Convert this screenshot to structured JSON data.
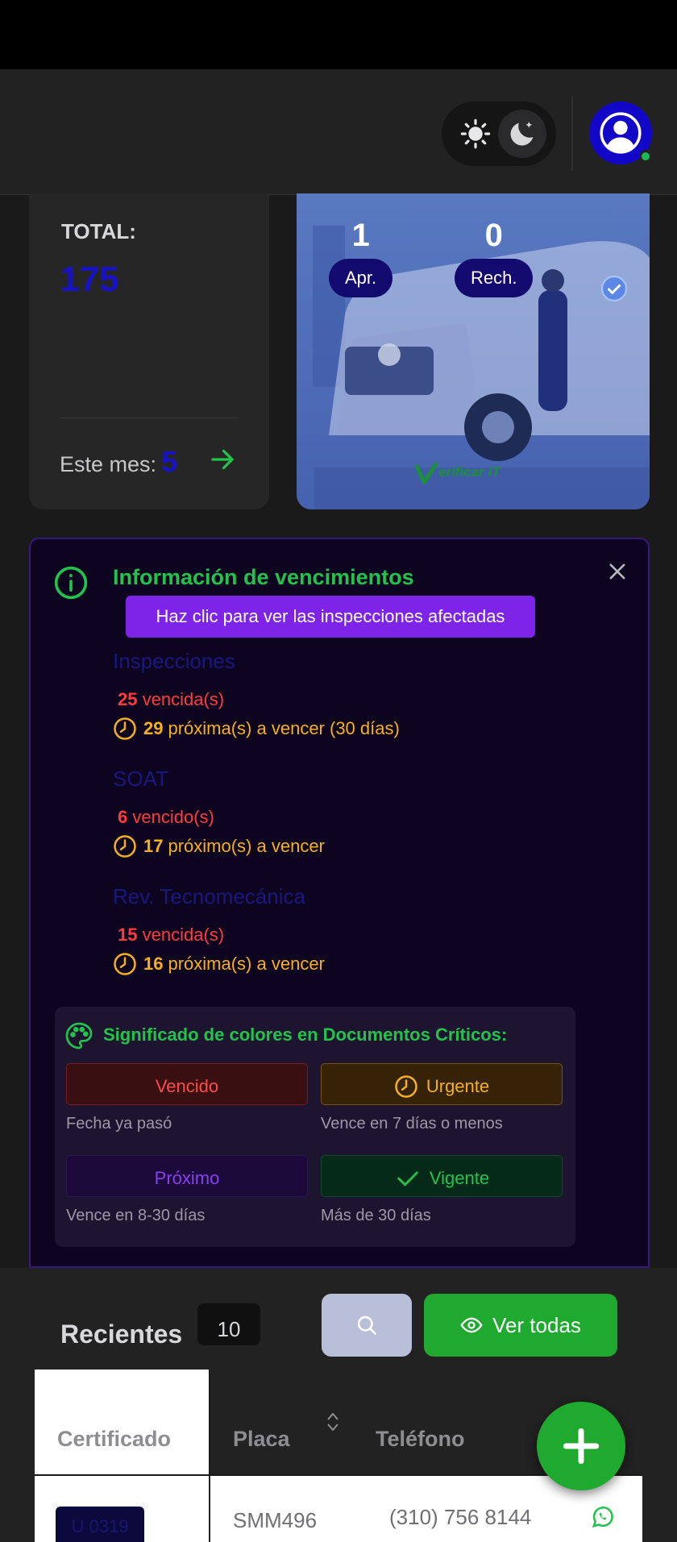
{
  "colors": {
    "accent_blue": "#1712c4",
    "success_green": "#21c34a",
    "button_green": "#1faa2f",
    "danger_red": "#ff3b3b",
    "warning_amber": "#f5b01a",
    "purple": "#7e24e8"
  },
  "header": {
    "theme_icons": [
      "sun-icon",
      "moon-icon"
    ],
    "avatar_icon": "user-icon"
  },
  "summary": {
    "total_label": "TOTAL:",
    "total_value": "175",
    "month_label": "Este mes:",
    "month_value": "5"
  },
  "inspections": {
    "approved_count": "1",
    "approved_label": "Apr.",
    "rejected_count": "0",
    "rejected_label": "Rech.",
    "logo_text": "erificar IT"
  },
  "alert": {
    "title": "Información de vencimientos",
    "hint": "Haz clic para ver las inspecciones afectadas",
    "sections": [
      {
        "title": "Inspecciones",
        "expired_count": "25",
        "expired_text": "vencida(s)",
        "upcoming_count": "29",
        "upcoming_text": "próxima(s) a vencer (30 días)"
      },
      {
        "title": "SOAT",
        "expired_count": "6",
        "expired_text": "vencido(s)",
        "upcoming_count": "17",
        "upcoming_text": "próximo(s) a vencer"
      },
      {
        "title": "Rev. Tecnomecánica",
        "expired_count": "15",
        "expired_text": "vencida(s)",
        "upcoming_count": "16",
        "upcoming_text": "próxima(s) a vencer"
      }
    ],
    "legend": {
      "title": "Significado de colores en Documentos Críticos:",
      "items": [
        {
          "label": "Vencido",
          "desc": "Fecha ya pasó"
        },
        {
          "label": "Urgente",
          "desc": "Vence en 7 días o menos"
        },
        {
          "label": "Próximo",
          "desc": "Vence en 8-30 días"
        },
        {
          "label": "Vigente",
          "desc": "Más de 30 días"
        }
      ]
    }
  },
  "recent": {
    "title": "Recientes",
    "count": "10",
    "view_all_label": "Ver todas",
    "columns": [
      "Certificado",
      "Placa",
      "Teléfono"
    ],
    "rows": [
      {
        "certificado": "U 0319",
        "placa": "SMM496",
        "telefono": "(310) 756 8144"
      }
    ]
  }
}
